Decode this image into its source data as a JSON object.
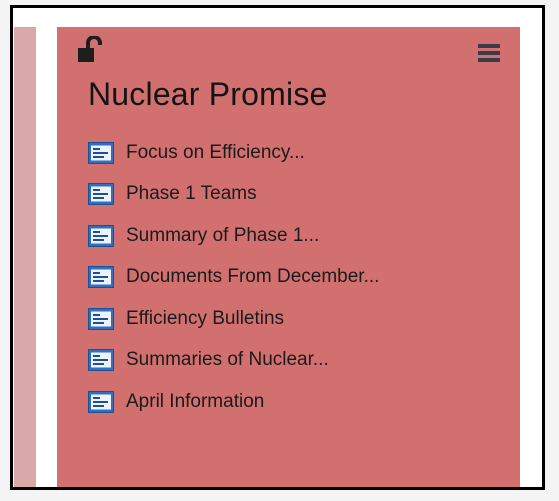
{
  "widget": {
    "title": "Nuclear Promise",
    "icons": {
      "lock": "unlocked-padlock-icon",
      "menu": "hamburger-menu-icon",
      "item": "document-icon"
    },
    "colors": {
      "panel_bg": "#d27070",
      "left_strip": "#d9a8a8",
      "frame_border": "#000000",
      "text": "#1a1a1a",
      "icon_blue": "#2f6fc0"
    },
    "items": [
      {
        "label": "Focus on Efficiency..."
      },
      {
        "label": "Phase 1 Teams"
      },
      {
        "label": "Summary of Phase 1..."
      },
      {
        "label": "Documents From December..."
      },
      {
        "label": "Efficiency Bulletins"
      },
      {
        "label": "Summaries of Nuclear..."
      },
      {
        "label": "April Information"
      }
    ]
  }
}
